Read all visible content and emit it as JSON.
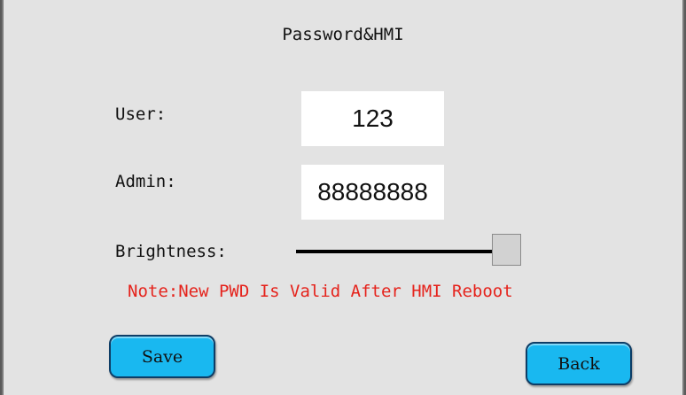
{
  "screen": {
    "title": "Password&HMI"
  },
  "form": {
    "user_label": "User:",
    "user_value": "123",
    "admin_label": "Admin:",
    "admin_value": "88888888",
    "brightness_label": "Brightness:",
    "brightness_level": 0.95
  },
  "note": "Note:New PWD Is Valid After HMI Reboot",
  "buttons": {
    "save_label": "Save",
    "back_label": "Back"
  },
  "colors": {
    "background": "#e3e3e3",
    "note_text": "#e5231c",
    "button_fill": "#19b8f0",
    "button_border": "#0e3d66"
  }
}
